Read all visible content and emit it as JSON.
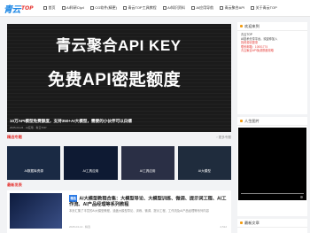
{
  "brand": {
    "logo_main": "青云",
    "logo_sub": "TOP"
  },
  "nav": [
    {
      "label": "首页"
    },
    {
      "label": "AI科研Ciyd"
    },
    {
      "label": "CG软件(精更)"
    },
    {
      "label": "青云TOP工具教程"
    },
    {
      "label": "AI知识资料"
    },
    {
      "label": "AI应用导航"
    },
    {
      "label": "青云聚合API"
    },
    {
      "label": "关于青云TOP"
    }
  ],
  "hero": {
    "line1": "青云聚合API KEY",
    "line2": "免费API密匙额度",
    "caption": "10万API模型免费额度，支持350+AI大模型，需要的小伙伴可以白嫖",
    "meta": "2025-04-24 · AI应用 · 青云TOP"
  },
  "section_a": {
    "title": "精选专题",
    "more": "› 更多专题"
  },
  "thumbs": [
    {
      "caption": "AI数据库资源"
    },
    {
      "caption": "AI工具应用"
    },
    {
      "caption": "AI工具应用"
    },
    {
      "caption": "AI大模型"
    }
  ],
  "section_b": {
    "title": "最新发表"
  },
  "post": {
    "tag": "精选",
    "title": "AI大模型教程合集：大模型导论、大模型训练、微调、提示词工程、AI工作流、AI产品经理等系列教程",
    "desc": "本页汇集了丰富的AI大模型教程，涵盖大模型导论、训练、微调、提示工程、工作流及AI产品经理等系列内容",
    "date": "2025-04-14 · 精选",
    "views": "2,512"
  },
  "sidebar": {
    "welcome": {
      "title": "欢迎来到",
      "lines": [
        "青云TOP",
        "AI技术分享平台，欢迎你加入",
        "找资源请登录",
        "联系邮箱：10001774",
        "青云聚合API免费额度领取"
      ]
    },
    "life": {
      "title": "人生图片"
    },
    "latest": {
      "title": "最新文章"
    }
  },
  "colors": {
    "accent": "#e53935",
    "brand": "#1e88e5"
  }
}
